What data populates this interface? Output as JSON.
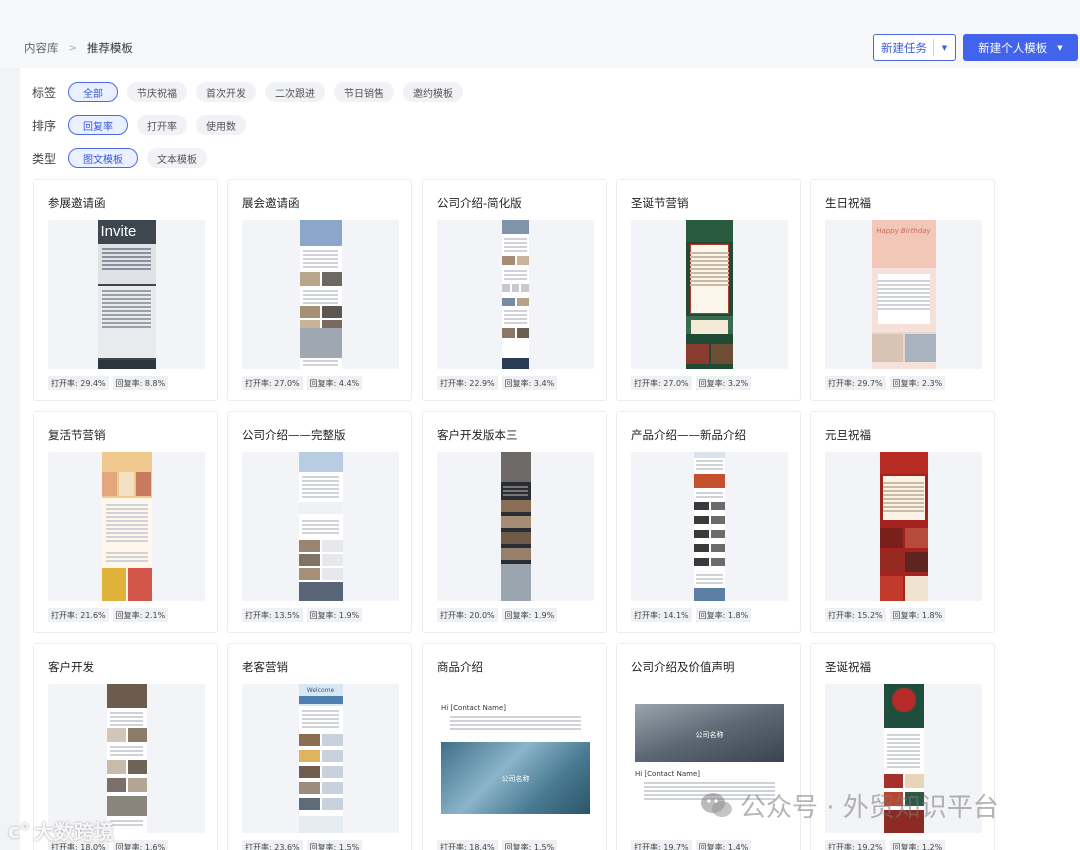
{
  "breadcrumb": {
    "root": "内容库",
    "current": "推荐模板"
  },
  "header": {
    "new_task": "新建任务",
    "new_template": "新建个人模板"
  },
  "filters": [
    {
      "label": "标签",
      "options": [
        "全部",
        "节庆祝福",
        "首次开发",
        "二次跟进",
        "节日销售",
        "邀约模板"
      ],
      "active": 0
    },
    {
      "label": "排序",
      "options": [
        "回复率",
        "打开率",
        "使用数"
      ],
      "active": 0
    },
    {
      "label": "类型",
      "options": [
        "图文模板",
        "文本模板"
      ],
      "active": 0
    }
  ],
  "cards": [
    {
      "title": "参展邀请函",
      "open": "打开率: 29.4%",
      "reply": "回复率: 8.8%",
      "style": "invite",
      "thumb_text": "Invite"
    },
    {
      "title": "展会邀请函",
      "open": "打开率: 27.0%",
      "reply": "回复率: 4.4%",
      "style": "expo"
    },
    {
      "title": "公司介绍-简化版",
      "open": "打开率: 22.9%",
      "reply": "回复率: 3.4%",
      "style": "company"
    },
    {
      "title": "圣诞节营销",
      "open": "打开率: 27.0%",
      "reply": "回复率: 3.2%",
      "style": "xmas"
    },
    {
      "title": "生日祝福",
      "open": "打开率: 29.7%",
      "reply": "回复率: 2.3%",
      "style": "birthday",
      "thumb_text": "Happy Birthday"
    },
    {
      "title": "复活节营销",
      "open": "打开率: 21.6%",
      "reply": "回复率: 2.1%",
      "style": "easter"
    },
    {
      "title": "公司介绍——完整版",
      "open": "打开率: 13.5%",
      "reply": "回复率: 1.9%",
      "style": "fullco"
    },
    {
      "title": "客户开发版本三",
      "open": "打开率: 20.0%",
      "reply": "回复率: 1.9%",
      "style": "dark"
    },
    {
      "title": "产品介绍——新品介绍",
      "open": "打开率: 14.1%",
      "reply": "回复率: 1.8%",
      "style": "product"
    },
    {
      "title": "元旦祝福",
      "open": "打开率: 15.2%",
      "reply": "回复率: 1.8%",
      "style": "newyear"
    },
    {
      "title": "客户开发",
      "open": "打开率: 18.0%",
      "reply": "回复率: 1.6%",
      "style": "dev"
    },
    {
      "title": "老客营销",
      "open": "打开率: 23.6%",
      "reply": "回复率: 1.5%",
      "style": "welcome",
      "thumb_text": "Welcome"
    },
    {
      "title": "商品介绍",
      "open": "打开率: 18.4%",
      "reply": "回复率: 1.5%",
      "style": "goods",
      "thumb_text": "Hi [Contact Name]",
      "thumb_sub": "公司名称"
    },
    {
      "title": "公司介绍及价值声明",
      "open": "打开率: 19.7%",
      "reply": "回复率: 1.4%",
      "style": "value",
      "thumb_text": "Hi [Contact Name]",
      "thumb_sub": "公司名称"
    },
    {
      "title": "圣诞祝福",
      "open": "打开率: 19.2%",
      "reply": "回复率: 1.2%",
      "style": "xmas2"
    }
  ],
  "watermark": {
    "left": "大数跨境",
    "right": "公众号 · 外贸知识平台"
  }
}
